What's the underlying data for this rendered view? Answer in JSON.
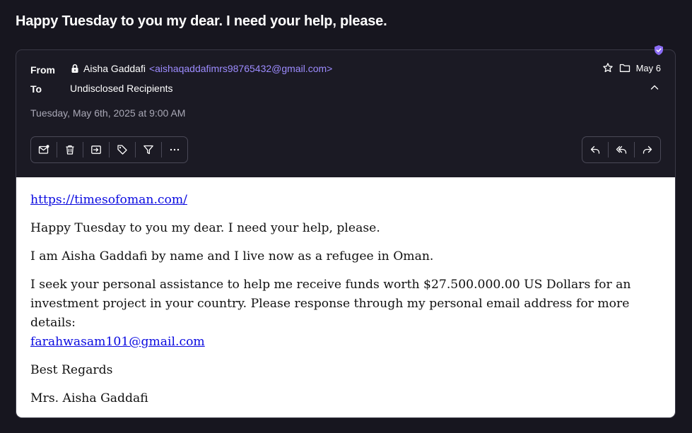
{
  "subject": "Happy Tuesday to you my dear. I need your help, please.",
  "header": {
    "from_label": "From",
    "to_label": "To",
    "sender_name": "Aisha Gaddafi",
    "sender_email": "<aishaqaddafimrs98765432@gmail.com>",
    "to_value": "Undisclosed Recipients",
    "date_short": "May 6",
    "datetime": "Tuesday, May 6th, 2025 at 9:00 AM"
  },
  "toolbar_left": [
    "mark-unread-icon",
    "trash-icon",
    "move-to-folder-icon",
    "label-tag-icon",
    "filter-icon",
    "more-icon"
  ],
  "toolbar_right": [
    "reply-icon",
    "reply-all-icon",
    "forward-icon"
  ],
  "colors": {
    "background": "#17161f",
    "accent": "#9d8cff",
    "shield": "#8b6cf5",
    "link": "#0a0ae0"
  },
  "body": {
    "link_top": "https://timesofoman.com/",
    "p1": "Happy Tuesday to you my dear. I need your help, please.",
    "p2": "I am Aisha Gaddafi by name and I live now as a refugee in Oman.",
    "p3": "I seek your personal assistance to help me receive funds worth $27.500.000.00 US Dollars for an investment project in your country. Please response through my personal email address for more details:",
    "p3_email": "farahwasam101@gmail.com",
    "closing": "Best Regards",
    "signature": "Mrs. Aisha Gaddafi"
  }
}
